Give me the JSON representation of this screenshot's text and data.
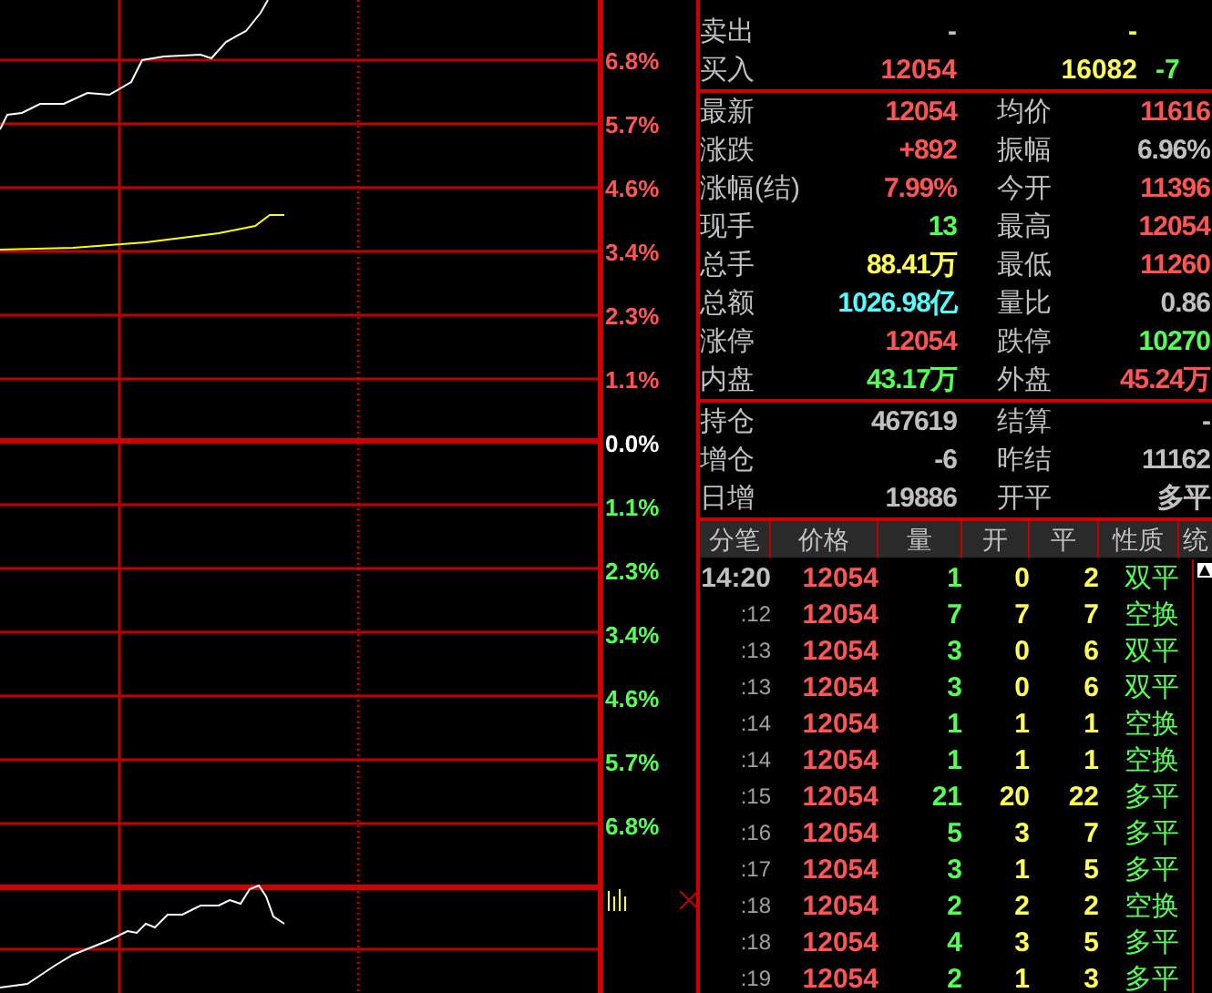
{
  "axis_labels": [
    {
      "label": "6.8%",
      "color": "#ff5555"
    },
    {
      "label": "5.7%",
      "color": "#ff5555"
    },
    {
      "label": "4.6%",
      "color": "#ff5555"
    },
    {
      "label": "3.4%",
      "color": "#ff5555"
    },
    {
      "label": "2.3%",
      "color": "#ff5555"
    },
    {
      "label": "1.1%",
      "color": "#ff5555"
    },
    {
      "label": "0.0%",
      "color": "#ffffff"
    },
    {
      "label": "1.1%",
      "color": "#55ff55"
    },
    {
      "label": "2.3%",
      "color": "#55ff55"
    },
    {
      "label": "3.4%",
      "color": "#55ff55"
    },
    {
      "label": "4.6%",
      "color": "#55ff55"
    },
    {
      "label": "5.7%",
      "color": "#55ff55"
    },
    {
      "label": "6.8%",
      "color": "#55ff55"
    }
  ],
  "order_book": [
    {
      "label": "卖出",
      "price": "-",
      "volume": "-"
    },
    {
      "label": "买入",
      "price": "12054",
      "volume": "16082",
      "change": "-7"
    }
  ],
  "stats": [
    {
      "left": {
        "label": "最新",
        "value": "12054",
        "color": "#ff5555"
      },
      "right": {
        "label": "均价",
        "value": "11616",
        "color": "#ff5555"
      }
    },
    {
      "left": {
        "label": "涨跌",
        "value": "+892",
        "color": "#ff5555"
      },
      "right": {
        "label": "振幅",
        "value": "6.96%",
        "color": "#c0c0c0"
      }
    },
    {
      "left": {
        "label": "涨幅(结)",
        "value": "7.99%",
        "color": "#ff5555"
      },
      "right": {
        "label": "今开",
        "value": "11396",
        "color": "#ff5555"
      }
    },
    {
      "left": {
        "label": "现手",
        "value": "13",
        "color": "#55ff55"
      },
      "right": {
        "label": "最高",
        "value": "12054",
        "color": "#ff5555"
      }
    },
    {
      "left": {
        "label": "总手",
        "value": "88.41万",
        "color": "#ffff55"
      },
      "right": {
        "label": "最低",
        "value": "11260",
        "color": "#ff5555"
      }
    },
    {
      "left": {
        "label": "总额",
        "value": "1026.98亿",
        "color": "#55ffff"
      },
      "right": {
        "label": "量比",
        "value": "0.86",
        "color": "#c0c0c0"
      }
    },
    {
      "left": {
        "label": "涨停",
        "value": "12054",
        "color": "#ff5555"
      },
      "right": {
        "label": "跌停",
        "value": "10270",
        "color": "#55ff55"
      }
    },
    {
      "left": {
        "label": "内盘",
        "value": "43.17万",
        "color": "#55ff55"
      },
      "right": {
        "label": "外盘",
        "value": "45.24万",
        "color": "#ff5555"
      }
    }
  ],
  "positions": [
    {
      "left": {
        "label": "持仓",
        "value": "467619"
      },
      "right": {
        "label": "结算",
        "value": "-"
      }
    },
    {
      "left": {
        "label": "增仓",
        "value": "-6"
      },
      "right": {
        "label": "昨结",
        "value": "11162"
      }
    },
    {
      "left": {
        "label": "日增",
        "value": "19886"
      },
      "right": {
        "label": "开平",
        "value": "多平"
      }
    }
  ],
  "ticks": {
    "columns": [
      "分笔",
      "价格",
      "量",
      "开",
      "平",
      "性质",
      "统"
    ],
    "rows": [
      {
        "kind": "full",
        "time": "14:20",
        "price": "12054",
        "volume": "1",
        "open": "0",
        "close": "2",
        "nature": "双平"
      },
      {
        "kind": "minute",
        "time": ":12",
        "price": "12054",
        "volume": "7",
        "open": "7",
        "close": "7",
        "nature": "空换"
      },
      {
        "kind": "minute",
        "time": ":13",
        "price": "12054",
        "volume": "3",
        "open": "0",
        "close": "6",
        "nature": "双平"
      },
      {
        "kind": "minute",
        "time": ":13",
        "price": "12054",
        "volume": "3",
        "open": "0",
        "close": "6",
        "nature": "双平"
      },
      {
        "kind": "minute",
        "time": ":14",
        "price": "12054",
        "volume": "1",
        "open": "1",
        "close": "1",
        "nature": "空换"
      },
      {
        "kind": "minute",
        "time": ":14",
        "price": "12054",
        "volume": "1",
        "open": "1",
        "close": "1",
        "nature": "空换"
      },
      {
        "kind": "minute",
        "time": ":15",
        "price": "12054",
        "volume": "21",
        "open": "20",
        "close": "22",
        "nature": "多平"
      },
      {
        "kind": "minute",
        "time": ":16",
        "price": "12054",
        "volume": "5",
        "open": "3",
        "close": "7",
        "nature": "多平"
      },
      {
        "kind": "minute",
        "time": ":17",
        "price": "12054",
        "volume": "3",
        "open": "1",
        "close": "5",
        "nature": "多平"
      },
      {
        "kind": "minute",
        "time": ":18",
        "price": "12054",
        "volume": "2",
        "open": "2",
        "close": "2",
        "nature": "空换"
      },
      {
        "kind": "minute",
        "time": ":18",
        "price": "12054",
        "volume": "4",
        "open": "3",
        "close": "5",
        "nature": "多平"
      },
      {
        "kind": "minute",
        "time": ":19",
        "price": "12054",
        "volume": "2",
        "open": "1",
        "close": "3",
        "nature": "多平"
      }
    ]
  }
}
